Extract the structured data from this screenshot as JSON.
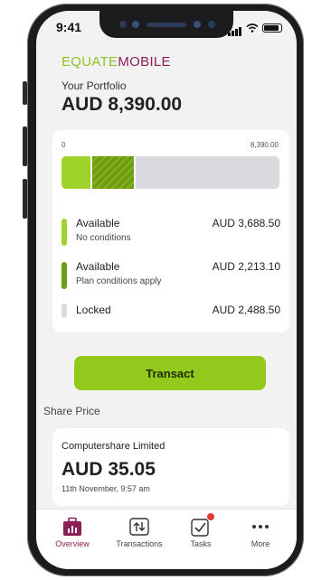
{
  "status_bar": {
    "time": "9:41"
  },
  "brand": {
    "part1": "EQUATE",
    "part2": "MOBILE"
  },
  "portfolio": {
    "label": "Your Portfolio",
    "value": "AUD 8,390.00",
    "scale_min": "0",
    "scale_max": "8,390.00",
    "allocation_fractions": {
      "available_no_conditions": 0.14,
      "available_plan_conditions": 0.2,
      "locked": 0.66
    },
    "rows": [
      {
        "title": "Available",
        "subtitle": "No conditions",
        "amount": "AUD 3,688.50",
        "color": "#9fd22a"
      },
      {
        "title": "Available",
        "subtitle": "Plan conditions apply",
        "amount": "AUD 2,213.10",
        "color": "#6f9c15"
      },
      {
        "title": "Locked",
        "subtitle": "",
        "amount": "AUD 2,488.50",
        "color": "#d9dbe0"
      }
    ]
  },
  "actions": {
    "transact_label": "Transact"
  },
  "share_price": {
    "section_label": "Share Price",
    "company": "Computershare Limited",
    "price": "AUD 35.05",
    "timestamp": "11th November, 9:57 am"
  },
  "tabbar": {
    "tabs": [
      {
        "label": "Overview",
        "icon": "briefcase-chart-icon",
        "active": true
      },
      {
        "label": "Transactions",
        "icon": "transfer-icon",
        "active": false
      },
      {
        "label": "Tasks",
        "icon": "checkbox-icon",
        "active": false,
        "badge": true
      },
      {
        "label": "More",
        "icon": "more-dots-icon",
        "active": false
      }
    ]
  },
  "colors": {
    "accent_green": "#93c91c",
    "brand_maroon": "#8b1e57",
    "badge_red": "#e53935"
  }
}
